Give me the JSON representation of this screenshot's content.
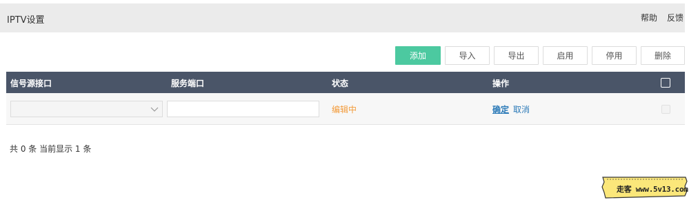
{
  "header": {
    "title": "IPTV设置",
    "help": "帮助",
    "feedback": "反馈"
  },
  "toolbar": {
    "add": "添加",
    "import": "导入",
    "export": "导出",
    "enable": "启用",
    "disable": "停用",
    "delete": "删除",
    "accent_color": "#4cc9a0"
  },
  "table": {
    "columns": [
      "信号源接口",
      "服务端口",
      "状态",
      "操作"
    ],
    "rows": [
      {
        "source_select_value": "",
        "service_port_value": "",
        "status": "编辑中",
        "confirm": "确定",
        "cancel": "取消"
      }
    ]
  },
  "footer": {
    "summary": "共 0 条 当前显示 1 条"
  },
  "badge": {
    "text": "走客 www.5v13.com"
  },
  "colors": {
    "header_bar": "#4a5568",
    "status": "#f39b3a",
    "link": "#2b7ab8"
  }
}
